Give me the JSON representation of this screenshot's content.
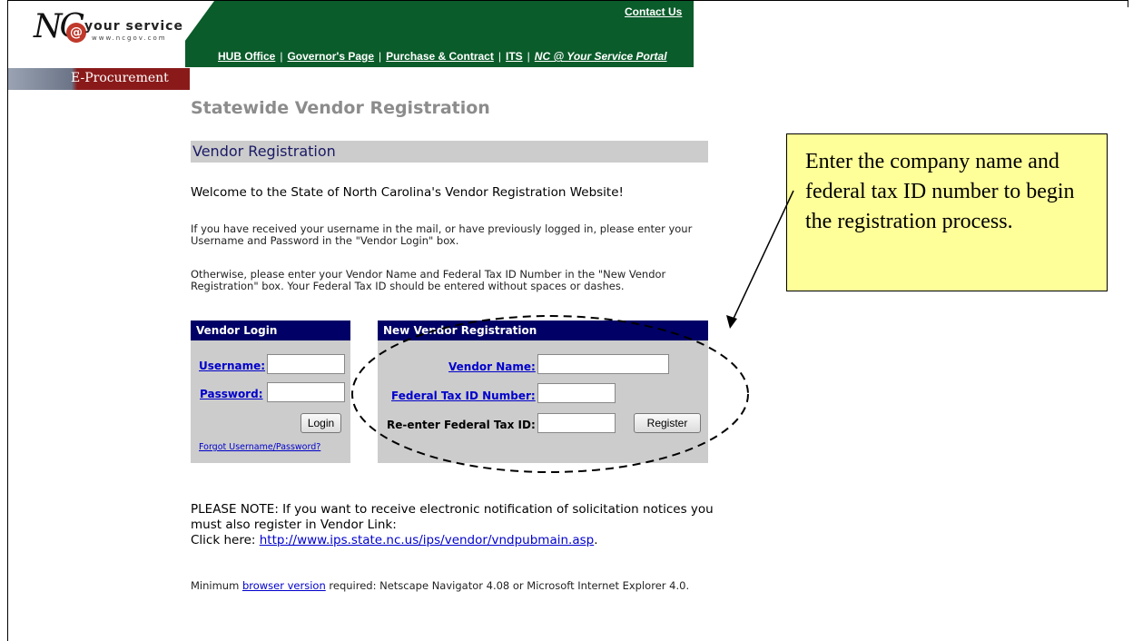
{
  "header": {
    "logo": {
      "main": "NC",
      "tagline": "your service",
      "url": "www.ncgov.com"
    },
    "section_label": "E-Procurement",
    "contact_link": "Contact Us",
    "nav": [
      "HUB Office",
      "Governor's Page",
      "Purchase & Contract",
      "ITS",
      "NC @ Your Service Portal"
    ]
  },
  "main": {
    "page_title": "Statewide Vendor Registration",
    "section_title": "Vendor Registration",
    "welcome": "Welcome to the State of North Carolina's Vendor Registration Website!",
    "para1": "If you have received your username in the mail, or have previously logged in, please enter your Username and Password in the \"Vendor Login\" box.",
    "para2": "Otherwise, please enter your Vendor Name and Federal Tax ID Number in the \"New Vendor Registration\" box. Your Federal Tax ID should be entered without spaces or dashes."
  },
  "login_box": {
    "title": "Vendor Login",
    "username_label": "Username:",
    "username_value": "",
    "password_label": "Password:",
    "password_value": "",
    "login_button": "Login",
    "forgot_link": "Forgot Username/Password?"
  },
  "register_box": {
    "title": "New Vendor Registration",
    "vendor_name_label": "Vendor Name:",
    "vendor_name_value": "",
    "tax_id_label": "Federal Tax ID Number:",
    "tax_id_value": "",
    "reenter_label": "Re-enter Federal Tax ID:",
    "reenter_value": "",
    "register_button": "Register"
  },
  "callout": {
    "text": "Enter the company name and federal tax ID number to begin the registration process."
  },
  "note": {
    "line1": "PLEASE NOTE: If you want to receive electronic notification of solicitation notices you must also register in Vendor Link:",
    "click_here": "Click here: ",
    "link": "http://www.ips.state.nc.us/ips/vendor/vndpubmain.asp",
    "period": "."
  },
  "min_version": {
    "prefix": "Minimum ",
    "link": "browser version",
    "suffix": " required: Netscape Navigator 4.08 or Microsoft Internet Explorer 4.0."
  },
  "colors": {
    "header_green": "#0a5c2a",
    "box_header_navy": "#000066",
    "callout_yellow": "#ffff99",
    "link_blue": "#0000cc"
  }
}
